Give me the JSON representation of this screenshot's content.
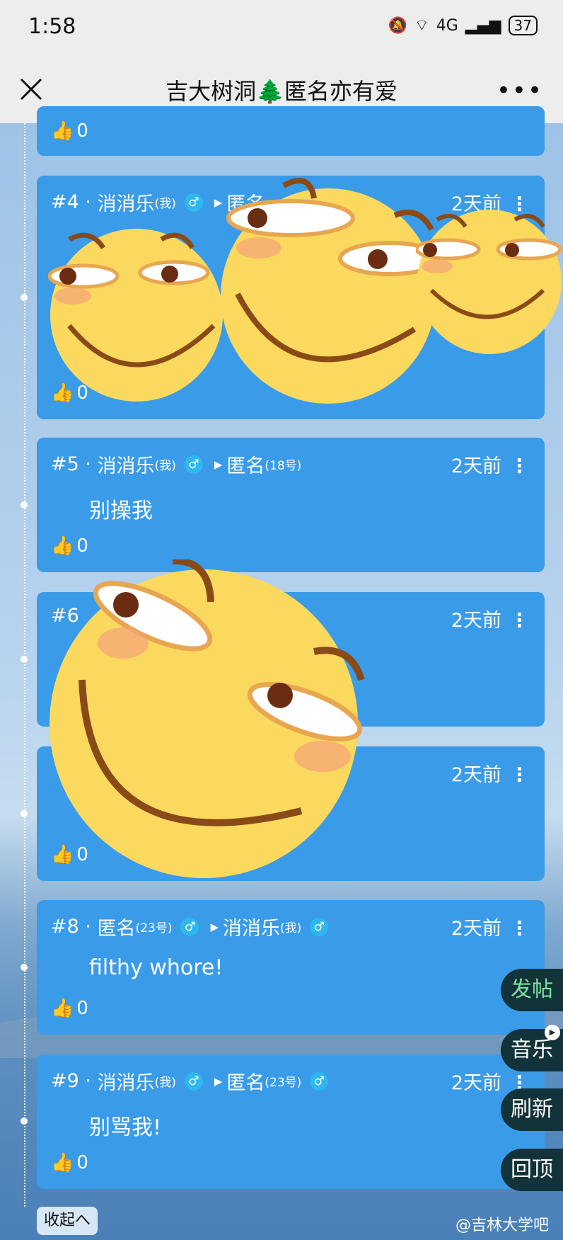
{
  "status": {
    "time": "1:58",
    "battery": "37",
    "network": "4G"
  },
  "nav": {
    "title": "吉大树洞🌲匿名亦有爱",
    "more": "•••"
  },
  "top_card": {
    "likes": "0"
  },
  "posts": [
    {
      "num": "#4",
      "author": "消消乐",
      "author_tag": "(我)",
      "gender": "♂",
      "target": "匿名",
      "target_tag": "",
      "time": "2天前",
      "text": "",
      "likes": "0"
    },
    {
      "num": "#5",
      "author": "消消乐",
      "author_tag": "(我)",
      "gender": "♂",
      "target": "匿名",
      "target_tag": "(18号)",
      "time": "2天前",
      "text": "别操我",
      "likes": "0"
    },
    {
      "num": "#6",
      "time": "2天前",
      "likes": "0"
    },
    {
      "time": "2天前",
      "likes": "0"
    },
    {
      "num": "#8",
      "author": "匿名",
      "author_tag": "(23号)",
      "gender": "♂",
      "target": "消消乐",
      "target_tag": "(我)",
      "time": "2天前",
      "text": "filthy whore!",
      "likes": "0"
    },
    {
      "num": "#9",
      "author": "消消乐",
      "author_tag": "(我)",
      "gender": "♂",
      "target": "匿名",
      "target_tag": "(23号)",
      "time": "2天前",
      "text": "别骂我!",
      "likes": "0"
    }
  ],
  "fabs": {
    "post": "发帖",
    "music": "音乐",
    "refresh": "刷新",
    "top": "回顶"
  },
  "collapse": "收起へ",
  "watermark": "@吉林大学吧"
}
